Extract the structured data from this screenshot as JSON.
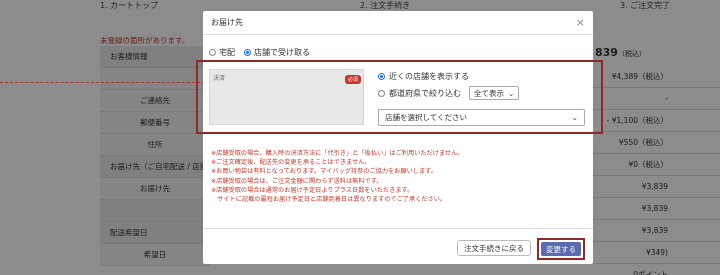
{
  "background": {
    "steps": [
      "1. カートトップ",
      "2. 注文手続き",
      "3. ご注文完了"
    ],
    "error_text": "未登録の箇所があります。",
    "rows": [
      {
        "label": "お客様情報",
        "type": "head"
      },
      {
        "label": "",
        "type": "shade"
      },
      {
        "label": "ご連絡先",
        "type": "shade"
      },
      {
        "label": "郵便番号",
        "type": "shade"
      },
      {
        "label": "住所",
        "type": "shade"
      },
      {
        "label": "お届け先（ご自宅配送 / 店舗",
        "type": "head"
      },
      {
        "label": "お届け先",
        "type": "shade"
      },
      {
        "label": "",
        "type": "head"
      },
      {
        "label": "配送希望日",
        "type": "head"
      },
      {
        "label": "希望日",
        "type": "shade"
      }
    ],
    "total": "839",
    "total_note": "（税込）",
    "prices": [
      "¥4,389（税込）",
      "-",
      "- ¥1,100（税込）",
      "¥550（税込）",
      "¥0（税込）",
      "¥3,839",
      "¥3,839",
      "¥3,839",
      "¥349)",
      "0ポイント"
    ]
  },
  "modal": {
    "title": "お届け先",
    "close": "×",
    "delivery_options": [
      "宅配",
      "店舗で受け取る"
    ],
    "store_box_label": "決済",
    "required_badge": "必須",
    "filter_option_nearby": "近くの店舗を表示する",
    "filter_option_prefecture": "都道府県で絞り込む",
    "prefecture_select": "全て表示",
    "store_select_placeholder": "店舗を選択してください",
    "notes": [
      "※店舗受取の場合、購入時の決済方法に「代引き」と「後払い」はご利用いただけません。",
      "※ご注文確定後、配送先の変更を承ることはできません。",
      "※お買い物袋は有料となっております。マイバッグ持参のご協力をお願いします。",
      "※店舗受取の場合は、ご注文金額に関わらず送料は無料です。",
      "※店舗受取の場合は通常のお届け予定日よりプラス日数をいただきます。",
      "　サイトに記載の最短お届け予定日と店舗到着日は異なりますのでご了承ください。"
    ],
    "back_button": "注文手続きに戻る",
    "change_button": "変更する"
  }
}
